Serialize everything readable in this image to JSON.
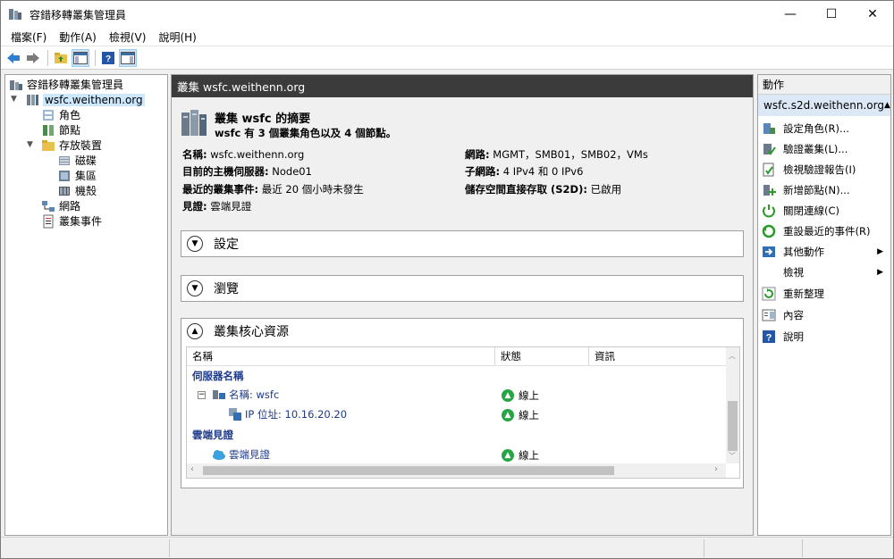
{
  "window": {
    "title": "容錯移轉叢集管理員",
    "controls": {
      "minimize": "—",
      "maximize": "☐",
      "close": "✕"
    }
  },
  "menu": [
    "檔案(F)",
    "動作(A)",
    "檢視(V)",
    "說明(H)"
  ],
  "tree": {
    "root": "容錯移轉叢集管理員",
    "cluster": "wsfc.weithenn.org",
    "items": {
      "roles": "角色",
      "nodes": "節點",
      "storage": "存放裝置",
      "disks": "磁碟",
      "pools": "集區",
      "enclosures": "機殼",
      "networks": "網路",
      "events": "叢集事件"
    }
  },
  "center": {
    "header": "叢集 wsfc.weithenn.org",
    "summary_title": "叢集 wsfc 的摘要",
    "summary_subtitle": "wsfc 有 3 個叢集角色以及 4 個節點。",
    "fields": {
      "name_label": "名稱:",
      "name_value": "wsfc.weithenn.org",
      "host_label": "目前的主機伺服器:",
      "host_value": "Node01",
      "events_label": "最近的叢集事件:",
      "events_value": "最近 20 個小時未發生",
      "witness_label": "見證:",
      "witness_value": "雲端見證",
      "networks_label": "網路:",
      "networks_value": "MGMT，SMB01，SMB02，VMs",
      "subnets_label": "子網路:",
      "subnets_value": "4 IPv4 和 0 IPv6",
      "s2d_label": "儲存空間直接存取 (S2D):",
      "s2d_value": "已啟用"
    },
    "sections": {
      "settings": "設定",
      "browse": "瀏覽",
      "core": "叢集核心資源"
    },
    "grid": {
      "columns": [
        "名稱",
        "狀態",
        "資訊"
      ],
      "group_server": "伺服器名稱",
      "row_name": "名稱: wsfc",
      "row_ip": "IP 位址: 10.16.20.20",
      "group_cloud": "雲端見證",
      "row_cloud": "雲端見證",
      "status_online": "線上"
    }
  },
  "actions": {
    "header": "動作",
    "context": "wsfc.s2d.weithenn.org",
    "items": [
      "設定角色(R)...",
      "驗證叢集(L)...",
      "檢視驗證報告(I)",
      "新增節點(N)...",
      "關閉連線(C)",
      "重設最近的事件(R)",
      "其他動作",
      "檢視",
      "重新整理",
      "內容",
      "說明"
    ]
  },
  "colors": {
    "center_header_bg": "#3b3b3b",
    "selection_bg": "#cce8ff",
    "action_context_bg": "#dce8f6",
    "online_green": "#27a544",
    "link_blue": "#1e3a8a"
  }
}
